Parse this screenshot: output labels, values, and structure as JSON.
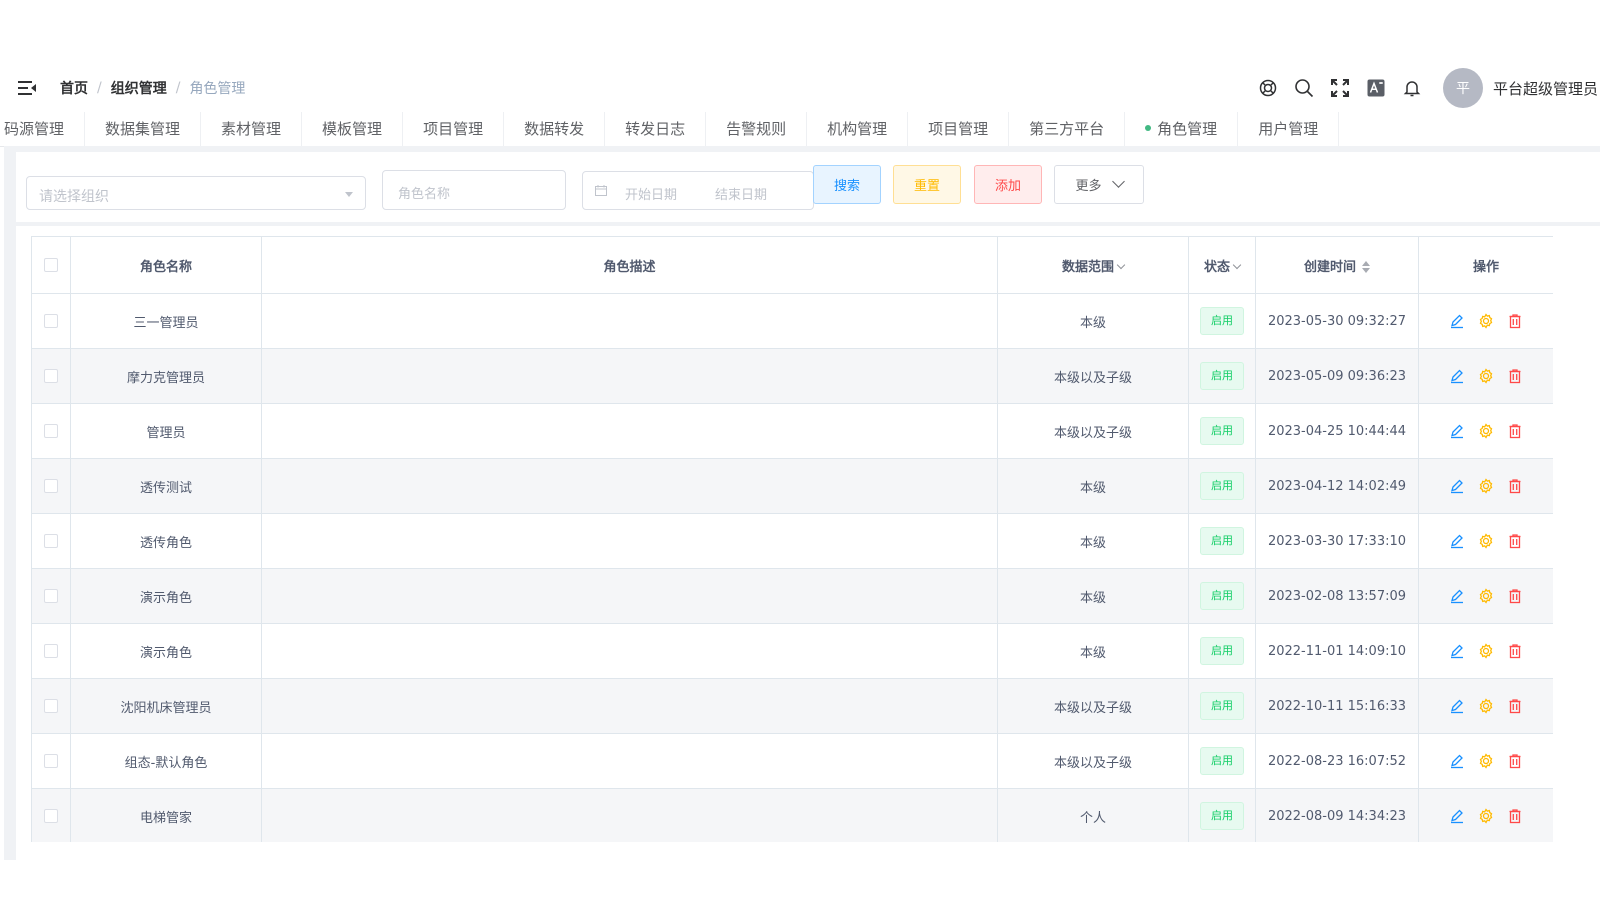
{
  "navbar": {
    "breadcrumb": [
      {
        "label": "首页"
      },
      {
        "label": "组织管理"
      },
      {
        "label": "角色管理"
      }
    ],
    "separator": "/",
    "avatar_text": "平",
    "username": "平台超级管理员"
  },
  "tags": [
    {
      "label": "码源管理",
      "display": "码源管理"
    },
    {
      "label": "数据集管理"
    },
    {
      "label": "素材管理"
    },
    {
      "label": "模板管理"
    },
    {
      "label": "项目管理"
    },
    {
      "label": "数据转发"
    },
    {
      "label": "转发日志"
    },
    {
      "label": "告警规则"
    },
    {
      "label": "机构管理"
    },
    {
      "label": "项目管理"
    },
    {
      "label": "第三方平台"
    },
    {
      "label": "角色管理",
      "active": true
    },
    {
      "label": "用户管理"
    }
  ],
  "search": {
    "org_placeholder": "请选择组织",
    "role_placeholder": "角色名称",
    "start_placeholder": "开始日期",
    "end_placeholder": "结束日期",
    "search_label": "搜索",
    "reset_label": "重置",
    "add_label": "添加",
    "more_label": "更多"
  },
  "table": {
    "columns": {
      "name": "角色名称",
      "desc": "角色描述",
      "scope": "数据范围",
      "status": "状态",
      "created": "创建时间",
      "ops": "操作"
    },
    "rows": [
      {
        "name": "三一管理员",
        "desc": "",
        "scope": "本级",
        "status": "启用",
        "created": "2023-05-30 09:32:27"
      },
      {
        "name": "摩力克管理员",
        "desc": "",
        "scope": "本级以及子级",
        "status": "启用",
        "created": "2023-05-09 09:36:23"
      },
      {
        "name": "管理员",
        "desc": "",
        "scope": "本级以及子级",
        "status": "启用",
        "created": "2023-04-25 10:44:44"
      },
      {
        "name": "透传测试",
        "desc": "",
        "scope": "本级",
        "status": "启用",
        "created": "2023-04-12 14:02:49"
      },
      {
        "name": "透传角色",
        "desc": "",
        "scope": "本级",
        "status": "启用",
        "created": "2023-03-30 17:33:10"
      },
      {
        "name": "演示角色",
        "desc": "",
        "scope": "本级",
        "status": "启用",
        "created": "2023-02-08 13:57:09"
      },
      {
        "name": "演示角色",
        "desc": "",
        "scope": "本级",
        "status": "启用",
        "created": "2022-11-01 14:09:10"
      },
      {
        "name": "沈阳机床管理员",
        "desc": "",
        "scope": "本级以及子级",
        "status": "启用",
        "created": "2022-10-11 15:16:33"
      },
      {
        "name": "组态-默认角色",
        "desc": "",
        "scope": "本级以及子级",
        "status": "启用",
        "created": "2022-08-23 16:07:52"
      },
      {
        "name": "电梯管家",
        "desc": "",
        "scope": "个人",
        "status": "启用",
        "created": "2022-08-09 14:34:23"
      }
    ]
  },
  "colors": {
    "primary": "#1890ff",
    "warning": "#ffba00",
    "danger": "#ff4949",
    "success": "#13ce66",
    "active_dot": "#42b983",
    "edit_icon": "#1890ff",
    "settings_icon": "#ffba00",
    "delete_icon": "#ff4949"
  },
  "icons": {
    "nav": [
      "help-icon",
      "search-icon",
      "fullscreen-icon",
      "language-icon",
      "bell-icon"
    ],
    "ops": [
      "edit-icon",
      "settings-icon",
      "delete-icon"
    ]
  }
}
